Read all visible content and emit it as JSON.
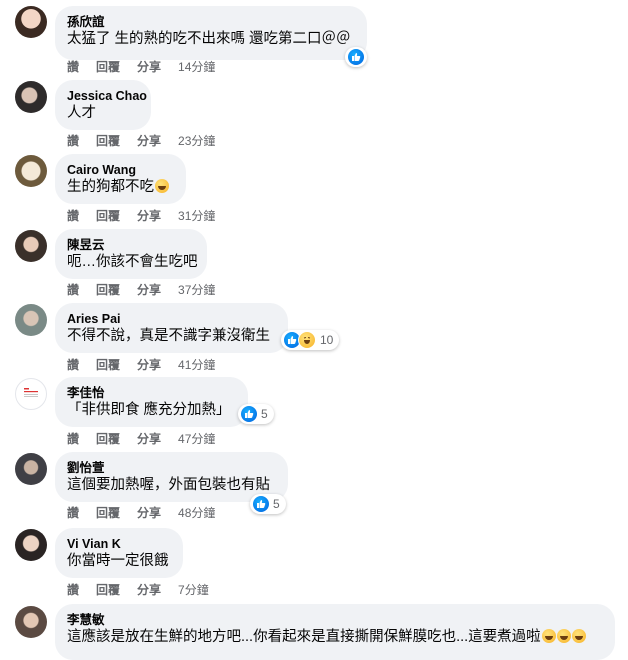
{
  "actions": {
    "like": "讚",
    "reply": "回覆",
    "share": "分享"
  },
  "colors": {
    "bubble": "#f0f2f5",
    "like_blue": "#0571ed",
    "secondary": "#65676b"
  },
  "comments": [
    {
      "name": "孫欣誼",
      "text": "太猛了 生的熟的吃不出來嗎 還吃第二口＠＠",
      "time": "14分鐘",
      "reactions": [
        "like"
      ],
      "reaction_count": ""
    },
    {
      "name": "Jessica Chao",
      "text": "人才",
      "time": "23分鐘",
      "reactions": [],
      "reaction_count": ""
    },
    {
      "name": "Cairo Wang",
      "text": "生的狗都不吃",
      "emoji": "grinning-squinting-face",
      "time": "31分鐘",
      "reactions": [],
      "reaction_count": ""
    },
    {
      "name": "陳昱云",
      "text": "呃…你該不會生吃吧",
      "time": "37分鐘",
      "reactions": [],
      "reaction_count": ""
    },
    {
      "name": "Aries Pai",
      "text": "不得不說，真是不識字兼沒衛生",
      "time": "41分鐘",
      "reactions": [
        "like",
        "haha"
      ],
      "reaction_count": "10"
    },
    {
      "name": "李佳怡",
      "text": "「非供即食 應充分加熱」",
      "time": "47分鐘",
      "reactions": [
        "like"
      ],
      "reaction_count": "5"
    },
    {
      "name": "劉怡萱",
      "text": "這個要加熱喔，外面包裝也有貼",
      "time": "48分鐘",
      "reactions": [
        "like"
      ],
      "reaction_count": "5"
    },
    {
      "name": "Vi Vian K",
      "text": "你當時一定很餓",
      "time": "7分鐘",
      "reactions": [],
      "reaction_count": ""
    },
    {
      "name": "李慧敏",
      "text": "這應該是放在生鮮的地方吧...你看起來是直接撕開保鮮膜吃也...這要煮過啦",
      "emoji": "rofl-x3",
      "time": "",
      "reactions": [],
      "reaction_count": ""
    }
  ]
}
